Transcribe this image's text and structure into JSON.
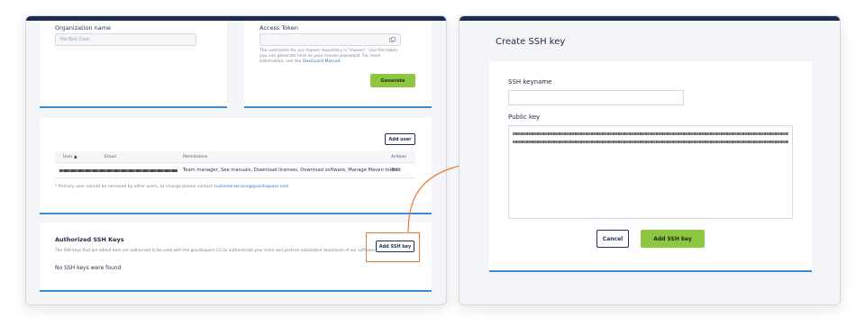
{
  "left_window": {
    "org": {
      "label": "Organization name",
      "value": "PenTest Corp"
    },
    "token": {
      "label": "Access Token",
      "help_line1": "The username for our maven repository is \"maven\". Use the token",
      "help_line2": "you can generate here as your maven password. For more",
      "help_line3_prefix": "information, see the ",
      "help_link": "DexGuard Manual",
      "help_line3_suffix": ".",
      "generate_label": "Generate"
    },
    "users": {
      "add_user_label": "Add user",
      "columns": {
        "user": "User",
        "email": "Email",
        "permissions": "Permissions",
        "actions": "Actions"
      },
      "rows": [
        {
          "permissions": "Team manager, See manuals, Download licenses, Download software, Manage Maven token",
          "action": "Edit"
        }
      ],
      "footnote_prefix": "* Primary user cannot be removed by other users, to change please contact ",
      "footnote_link": "customerservice@guardsquare.com"
    },
    "ssh": {
      "title": "Authorized SSH Keys",
      "description": "The SSH keys that are added here are authorized to be used with the guardsquare CLI to authenticate your team and perform automated downloads of our software.",
      "add_label": "Add SSH key",
      "empty_text": "No SSH keys were found"
    }
  },
  "right_window": {
    "title": "Create SSH key",
    "keyname_label": "SSH keyname",
    "keyname_value": "",
    "public_key_label": "Public key",
    "cancel_label": "Cancel",
    "add_label": "Add SSH key"
  },
  "colors": {
    "navy": "#1d2b4f",
    "accent_blue": "#3c8bd0",
    "green": "#8dc63f",
    "highlight_orange": "#ea7a32"
  }
}
